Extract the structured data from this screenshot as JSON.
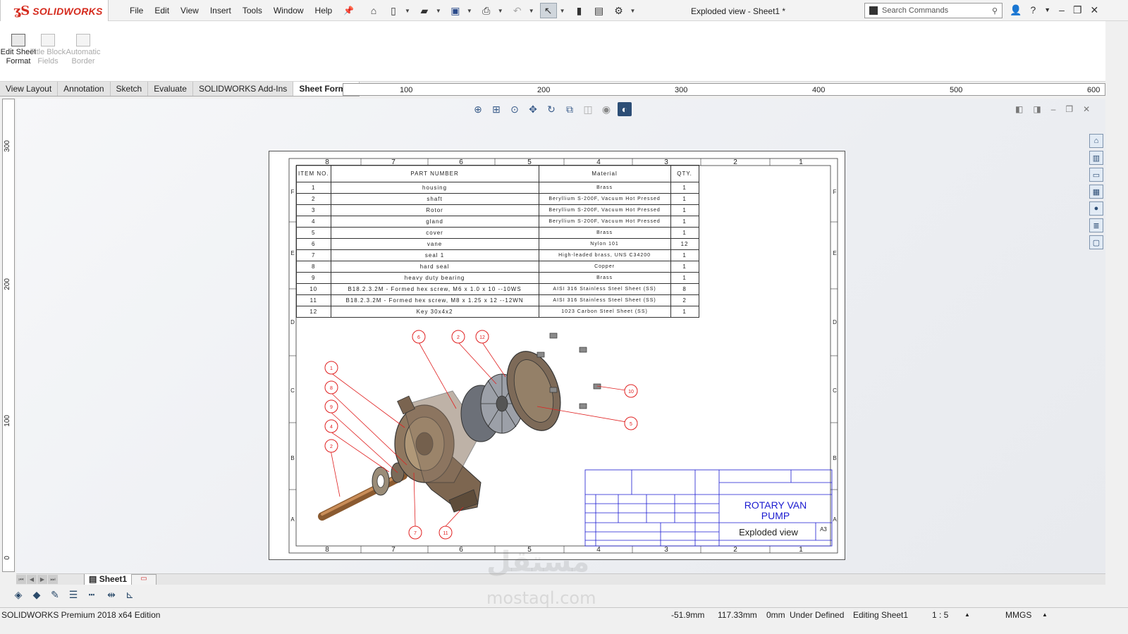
{
  "app": {
    "logo_text": "SOLIDWORKS",
    "window_title": "Exploded view - Sheet1 *"
  },
  "menu": [
    "File",
    "Edit",
    "View",
    "Insert",
    "Tools",
    "Window",
    "Help"
  ],
  "search": {
    "placeholder": "Search Commands"
  },
  "command_manager": {
    "edit_sheet_format": "Edit Sheet Format",
    "title_block_fields": "Title Block Fields",
    "automatic_border": "Automatic Border"
  },
  "tabs": [
    "View Layout",
    "Annotation",
    "Sketch",
    "Evaluate",
    "SOLIDWORKS Add-Ins",
    "Sheet Format"
  ],
  "active_tab": "Sheet Format",
  "ruler": {
    "h_labels": [
      "100",
      "200",
      "300",
      "400",
      "500",
      "600"
    ],
    "v_labels": [
      "300",
      "200",
      "100",
      "0"
    ]
  },
  "drawing": {
    "zone_numbers": [
      "8",
      "7",
      "6",
      "5",
      "4",
      "3",
      "2",
      "1"
    ],
    "zone_letters": [
      "F",
      "E",
      "D",
      "C",
      "B",
      "A"
    ],
    "bom_headers": {
      "item": "ITEM NO.",
      "part": "PART NUMBER",
      "material": "Material",
      "qty": "QTY."
    },
    "bom": [
      {
        "item": "1",
        "part": "housing",
        "material": "Brass",
        "qty": "1"
      },
      {
        "item": "2",
        "part": "shaft",
        "material": "Beryllium S-200F, Vacuum Hot Pressed",
        "qty": "1"
      },
      {
        "item": "3",
        "part": "Rotor",
        "material": "Beryllium S-200F, Vacuum Hot Pressed",
        "qty": "1"
      },
      {
        "item": "4",
        "part": "gland",
        "material": "Beryllium S-200F, Vacuum Hot Pressed",
        "qty": "1"
      },
      {
        "item": "5",
        "part": "cover",
        "material": "Brass",
        "qty": "1"
      },
      {
        "item": "6",
        "part": "vane",
        "material": "Nylon 101",
        "qty": "12"
      },
      {
        "item": "7",
        "part": "seal 1",
        "material": "High-leaded brass, UNS C34200",
        "qty": "1"
      },
      {
        "item": "8",
        "part": "hard seal",
        "material": "Copper",
        "qty": "1"
      },
      {
        "item": "9",
        "part": "heavy duty bearing",
        "material": "Brass",
        "qty": "1"
      },
      {
        "item": "10",
        "part": "B18.2.3.2M - Formed hex screw, M6 x 1.0 x 10 --10WS",
        "material": "AISI 316 Stainless Steel Sheet (SS)",
        "qty": "8"
      },
      {
        "item": "11",
        "part": "B18.2.3.2M - Formed hex screw, M8 x 1.25 x 12 --12WN",
        "material": "AISI 316 Stainless Steel Sheet (SS)",
        "qty": "2"
      },
      {
        "item": "12",
        "part": "Key 30x4x2",
        "material": "1023 Carbon Steel Sheet (SS)",
        "qty": "1"
      }
    ],
    "title_block": {
      "title_line1": "ROTARY VAN",
      "title_line2": "PUMP",
      "dwg_name": "Exploded view",
      "size": "A3"
    },
    "balloons": [
      "1",
      "2",
      "4",
      "5",
      "6",
      "7",
      "8",
      "9",
      "10",
      "11",
      "12"
    ]
  },
  "sheet_tab": "Sheet1",
  "status": {
    "edition": "SOLIDWORKS Premium 2018 x64 Edition",
    "x": "-51.9mm",
    "y": "117.33mm",
    "z": "0mm",
    "state": "Under Defined",
    "editing": "Editing Sheet1",
    "scale": "1 : 5",
    "units": "MMGS"
  },
  "watermark": {
    "arabic": "مستقل",
    "latin": "mostaql.com"
  },
  "colors": {
    "brand_red": "#d52b1e",
    "balloon_red": "#e02020",
    "titleblock_blue": "#1a1ad0",
    "part_bronze": "#8a6a48"
  }
}
